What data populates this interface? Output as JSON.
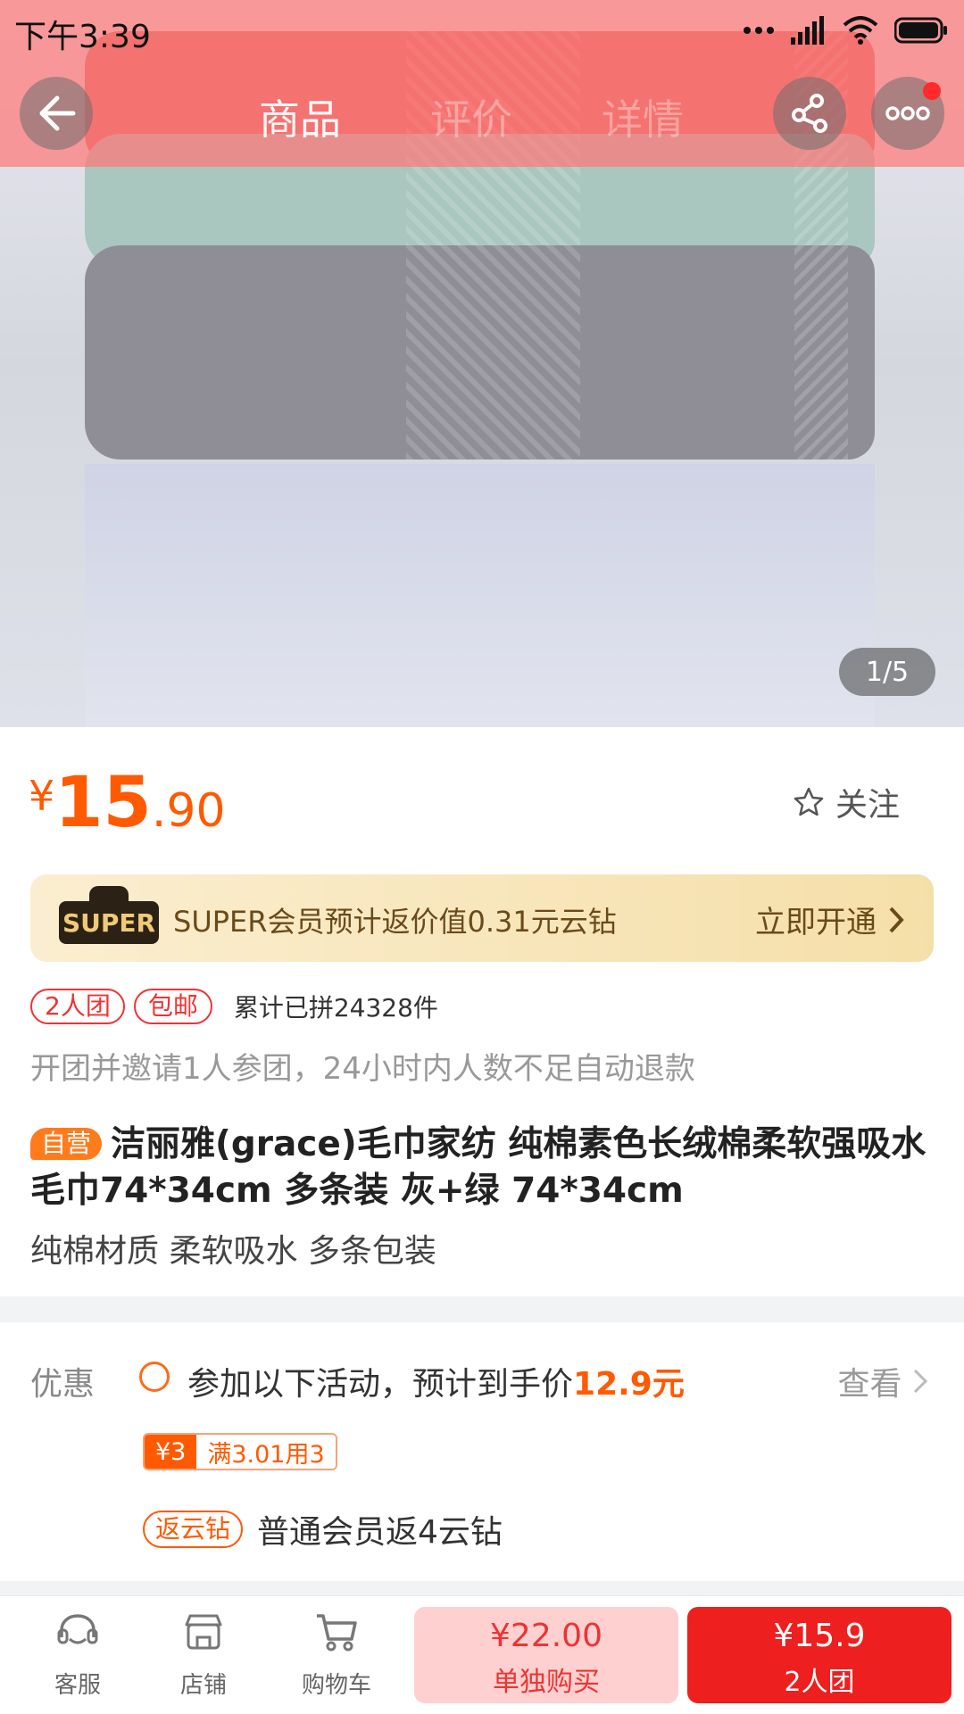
{
  "status_bar": {
    "time": "下午3:39"
  },
  "nav": {
    "tabs": [
      "商品",
      "评价",
      "详情"
    ],
    "has_notification_dot": true
  },
  "gallery": {
    "pager": "1/5"
  },
  "price": {
    "currency": "¥",
    "integer": "15",
    "decimal": ".90"
  },
  "follow_label": "关注",
  "super_banner": {
    "logo": "SUPER",
    "text": "SUPER会员预计返价值0.31元云钻",
    "cta": "立即开通"
  },
  "tags": [
    "2人团",
    "包邮"
  ],
  "sold_count": "累计已拼24328件",
  "group_tip": "开团并邀请1人参团，24小时内人数不足自动退款",
  "product": {
    "badge": "自营",
    "title": "洁丽雅(grace)毛巾家纺 纯棉素色长绒棉柔软强吸水毛巾74*34cm 多条装 灰+绿 74*34cm",
    "subtitle": "纯棉材质 柔软吸水 多条包装"
  },
  "promo": {
    "label": "优惠",
    "text_prefix": "参加以下活动，预计到手价",
    "highlight": "12.9元",
    "view": "查看",
    "coupon_amount": "¥3",
    "coupon_rule": "满3.01用3",
    "rebate_tag": "返云钻",
    "rebate_text": "普通会员返4云钻"
  },
  "bottom_bar": {
    "service": "客服",
    "shop": "店铺",
    "cart": "购物车",
    "single_price": "¥22.00",
    "single_label": "单独购买",
    "group_price": "¥15.9",
    "group_label": "2人团"
  },
  "colors": {
    "accent": "#ff5a00",
    "buy_red": "#ee1f1f",
    "header_overlay": "#ff7878"
  }
}
